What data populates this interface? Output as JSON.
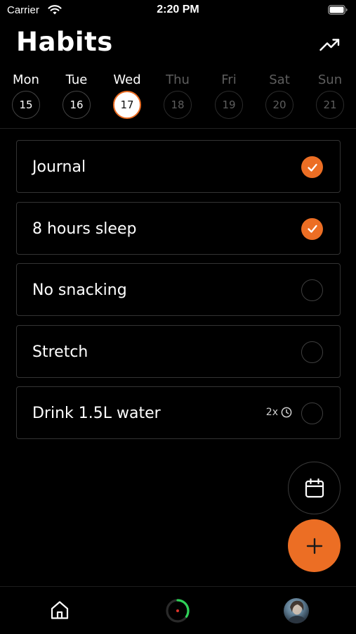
{
  "status_bar": {
    "carrier": "Carrier",
    "time": "2:20 PM"
  },
  "header": {
    "title": "Habits",
    "stats_icon": "trending-up-icon"
  },
  "days": [
    {
      "name": "Mon",
      "date": "15",
      "state": "past"
    },
    {
      "name": "Tue",
      "date": "16",
      "state": "past"
    },
    {
      "name": "Wed",
      "date": "17",
      "state": "today"
    },
    {
      "name": "Thu",
      "date": "18",
      "state": "future"
    },
    {
      "name": "Fri",
      "date": "19",
      "state": "future"
    },
    {
      "name": "Sat",
      "date": "20",
      "state": "future"
    },
    {
      "name": "Sun",
      "date": "21",
      "state": "future"
    }
  ],
  "habits": [
    {
      "name": "Journal",
      "done": true,
      "meta": ""
    },
    {
      "name": "8 hours sleep",
      "done": true,
      "meta": ""
    },
    {
      "name": "No snacking",
      "done": false,
      "meta": ""
    },
    {
      "name": "Stretch",
      "done": false,
      "meta": ""
    },
    {
      "name": "Drink 1.5L water",
      "done": false,
      "meta": "2x"
    }
  ],
  "fab": {
    "calendar_icon": "calendar-icon",
    "add_icon": "plus-icon"
  },
  "tab_bar": {
    "items": [
      "home-icon",
      "progress-ring-icon",
      "profile-avatar"
    ]
  },
  "colors": {
    "accent": "#ec6e24",
    "background": "#000000",
    "card_border": "#333333",
    "progress_green": "#2fd158",
    "progress_red": "#e0342a"
  }
}
